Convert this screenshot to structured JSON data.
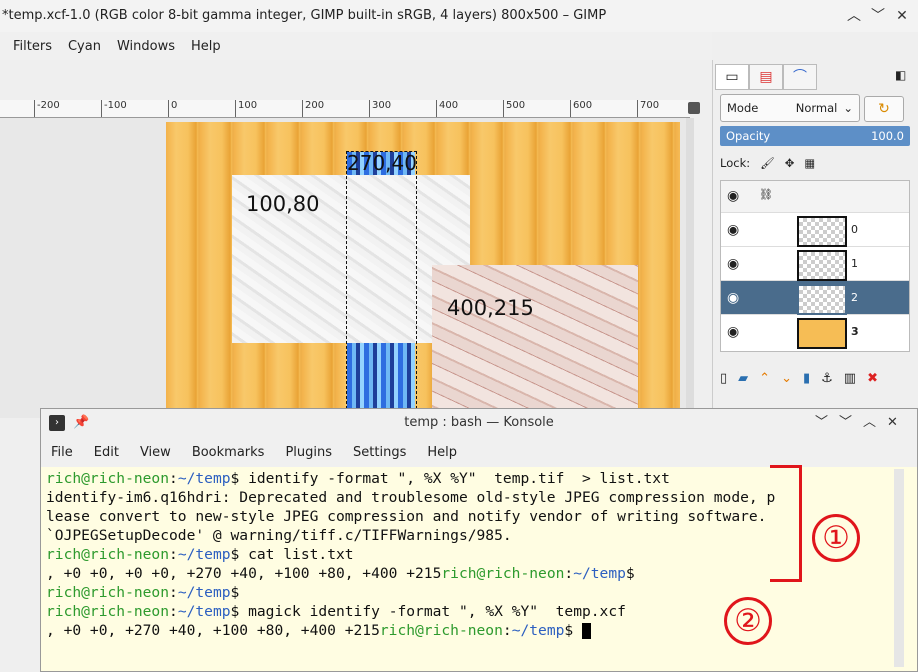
{
  "gimp": {
    "title": "*temp.xcf-1.0 (RGB color 8-bit gamma integer, GIMP built-in sRGB, 4 layers) 800x500 – GIMP",
    "menu": [
      "Filters",
      "Cyan",
      "Windows",
      "Help"
    ],
    "ruler_ticks": [
      "-200",
      "-100",
      "0",
      "100",
      "200",
      "300",
      "400",
      "500",
      "600",
      "700"
    ],
    "canvas_labels": {
      "white": "100,80",
      "marble": "400,215",
      "blue": "270,40"
    },
    "dock": {
      "mode_label": "Mode",
      "mode_value": "Normal",
      "opacity_label": "Opacity",
      "opacity_value": "100.0",
      "lock_label": "Lock:",
      "layers": [
        {
          "name": "0",
          "selected": false
        },
        {
          "name": "1",
          "selected": false
        },
        {
          "name": "2",
          "selected": true
        },
        {
          "name": "3",
          "selected": false
        }
      ]
    }
  },
  "konsole": {
    "title": "temp : bash — Konsole",
    "menu": [
      "File",
      "Edit",
      "View",
      "Bookmarks",
      "Plugins",
      "Settings",
      "Help"
    ],
    "prompt_user": "rich@rich-neon",
    "prompt_path": "~/temp",
    "lines": [
      {
        "type": "cmd",
        "text": " identify -format \", %X %Y\"  temp.tif  > list.txt"
      },
      {
        "type": "out",
        "text": "identify-im6.q16hdri: Deprecated and troublesome old-style JPEG compression mode, p"
      },
      {
        "type": "out",
        "text": "lease convert to new-style JPEG compression and notify vendor of writing software."
      },
      {
        "type": "out",
        "text": "`OJPEGSetupDecode' @ warning/tiff.c/TIFFWarnings/985."
      },
      {
        "type": "cmd",
        "text": " cat list.txt"
      },
      {
        "type": "outprompt",
        "text": ", +0 +0, +0 +0, +270 +40, +100 +80, +400 +215"
      },
      {
        "type": "cmd",
        "text": ""
      },
      {
        "type": "cmd",
        "text": " magick identify -format \", %X %Y\"  temp.xcf"
      },
      {
        "type": "outprompt_cursor",
        "text": ", +0 +0, +270 +40, +100 +80, +400 +215"
      }
    ]
  },
  "annotations": {
    "one": "①",
    "two": "②"
  },
  "colors": {
    "accent_red": "#e0151b",
    "prompt_green": "#2d9a2d",
    "prompt_blue": "#2c5fc0",
    "selection_blue": "#4a6c8c"
  }
}
